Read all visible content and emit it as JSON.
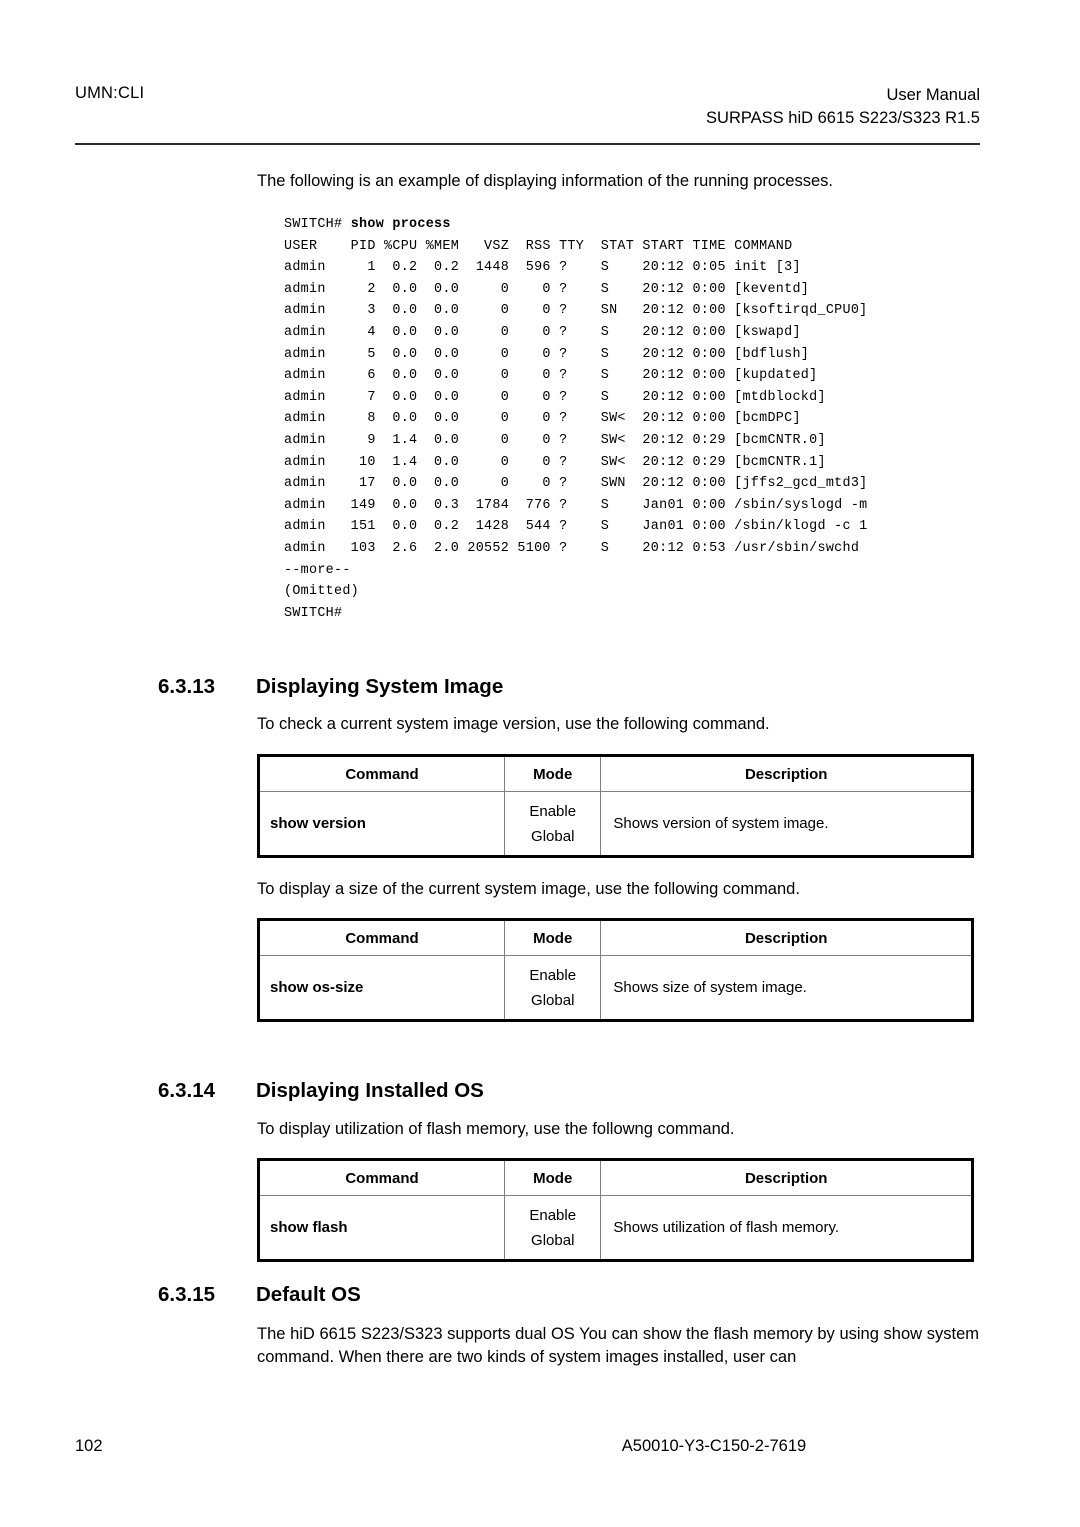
{
  "header": {
    "left": "UMN:CLI",
    "right_line1": "User Manual",
    "right_line2": "SURPASS hiD 6615 S223/S323 R1.5"
  },
  "intro_paragraph": "The following is an example of displaying information of the running processes.",
  "terminal": {
    "prompt": "SWITCH# ",
    "command": "show process",
    "columns": [
      "USER",
      "PID",
      "%CPU",
      "%MEM",
      "VSZ",
      "RSS",
      "TTY",
      "STAT",
      "START",
      "TIME",
      "COMMAND"
    ],
    "header_line": "USER     PID %CPU %MEM   VSZ  RSS TTY  STAT  START TIME COMMAND",
    "rows": [
      {
        "user": "admin",
        "pid": "1",
        "cpu": "0.2",
        "mem": "0.2",
        "vsz": "1448",
        "rss": "596",
        "tty": "?",
        "stat": "S",
        "start": "20:12",
        "time": "0:05",
        "command": "init [3]"
      },
      {
        "user": "admin",
        "pid": "2",
        "cpu": "0.0",
        "mem": "0.0",
        "vsz": "0",
        "rss": "0",
        "tty": "?",
        "stat": "S",
        "start": "20:12",
        "time": "0:00",
        "command": "[keventd]"
      },
      {
        "user": "admin",
        "pid": "3",
        "cpu": "0.0",
        "mem": "0.0",
        "vsz": "0",
        "rss": "0",
        "tty": "?",
        "stat": "SN",
        "start": "20:12",
        "time": "0:00",
        "command": "[ksoftirqd_CPU0]"
      },
      {
        "user": "admin",
        "pid": "4",
        "cpu": "0.0",
        "mem": "0.0",
        "vsz": "0",
        "rss": "0",
        "tty": "?",
        "stat": "S",
        "start": "20:12",
        "time": "0:00",
        "command": "[kswapd]"
      },
      {
        "user": "admin",
        "pid": "5",
        "cpu": "0.0",
        "mem": "0.0",
        "vsz": "0",
        "rss": "0",
        "tty": "?",
        "stat": "S",
        "start": "20:12",
        "time": "0:00",
        "command": "[bdflush]"
      },
      {
        "user": "admin",
        "pid": "6",
        "cpu": "0.0",
        "mem": "0.0",
        "vsz": "0",
        "rss": "0",
        "tty": "?",
        "stat": "S",
        "start": "20:12",
        "time": "0:00",
        "command": "[kupdated]"
      },
      {
        "user": "admin",
        "pid": "7",
        "cpu": "0.0",
        "mem": "0.0",
        "vsz": "0",
        "rss": "0",
        "tty": "?",
        "stat": "S",
        "start": "20:12",
        "time": "0:00",
        "command": "[mtdblockd]"
      },
      {
        "user": "admin",
        "pid": "8",
        "cpu": "0.0",
        "mem": "0.0",
        "vsz": "0",
        "rss": "0",
        "tty": "?",
        "stat": "SW<",
        "start": "20:12",
        "time": "0:00",
        "command": "[bcmDPC]"
      },
      {
        "user": "admin",
        "pid": "9",
        "cpu": "1.4",
        "mem": "0.0",
        "vsz": "0",
        "rss": "0",
        "tty": "?",
        "stat": "SW<",
        "start": "20:12",
        "time": "0:29",
        "command": "[bcmCNTR.0]"
      },
      {
        "user": "admin",
        "pid": "10",
        "cpu": "1.4",
        "mem": "0.0",
        "vsz": "0",
        "rss": "0",
        "tty": "?",
        "stat": "SW<",
        "start": "20:12",
        "time": "0:29",
        "command": "[bcmCNTR.1]"
      },
      {
        "user": "admin",
        "pid": "17",
        "cpu": "0.0",
        "mem": "0.0",
        "vsz": "0",
        "rss": "0",
        "tty": "?",
        "stat": "SWN",
        "start": "20:12",
        "time": "0:00",
        "command": "[jffs2_gcd_mtd3]"
      },
      {
        "user": "admin",
        "pid": "149",
        "cpu": "0.0",
        "mem": "0.3",
        "vsz": "1784",
        "rss": "776",
        "tty": "?",
        "stat": "S",
        "start": "Jan01",
        "time": "0:00",
        "command": "/sbin/syslogd -m"
      },
      {
        "user": "admin",
        "pid": "151",
        "cpu": "0.0",
        "mem": "0.2",
        "vsz": "1428",
        "rss": "544",
        "tty": "?",
        "stat": "S",
        "start": "Jan01",
        "time": "0:00",
        "command": "/sbin/klogd -c 1"
      },
      {
        "user": "admin",
        "pid": "103",
        "cpu": "2.6",
        "mem": "2.0",
        "vsz": "20552",
        "rss": "5100",
        "tty": "?",
        "stat": "S",
        "start": "20:12",
        "time": "0:53",
        "command": "/usr/sbin/swchd"
      }
    ],
    "more_marker": "--more--",
    "omitted_marker": "(Omitted)",
    "end_prompt": "SWITCH#"
  },
  "sections": [
    {
      "number": "6.3.13",
      "title": "Displaying System Image",
      "paragraph_1": "To check a current system image version, use the following command.",
      "paragraph_2": "To display a size of the current system image, use the following command."
    },
    {
      "number": "6.3.14",
      "title": "Displaying Installed OS",
      "paragraph_1": "To display utilization of flash memory, use the followng command."
    },
    {
      "number": "6.3.15",
      "title": "Default OS",
      "paragraph_1": "The hiD 6615 S223/S323 supports dual OS You can show the flash memory by using show system command. When there are two kinds of system images installed, user can"
    }
  ],
  "tables": {
    "headers": {
      "command": "Command",
      "mode": "Mode",
      "description": "Description"
    },
    "show_version": {
      "command": "show version",
      "mode_line1": "Enable",
      "mode_line2": "Global",
      "description": "Shows version of system image."
    },
    "show_os_size": {
      "command": "show os-size",
      "mode_line1": "Enable",
      "mode_line2": "Global",
      "description": "Shows size of system image."
    },
    "show_flash": {
      "command": "show flash",
      "mode_line1": "Enable",
      "mode_line2": "Global",
      "description": "Shows utilization of flash memory."
    }
  },
  "footer": {
    "page_number": "102",
    "doc_code": "A50010-Y3-C150-2-7619"
  }
}
